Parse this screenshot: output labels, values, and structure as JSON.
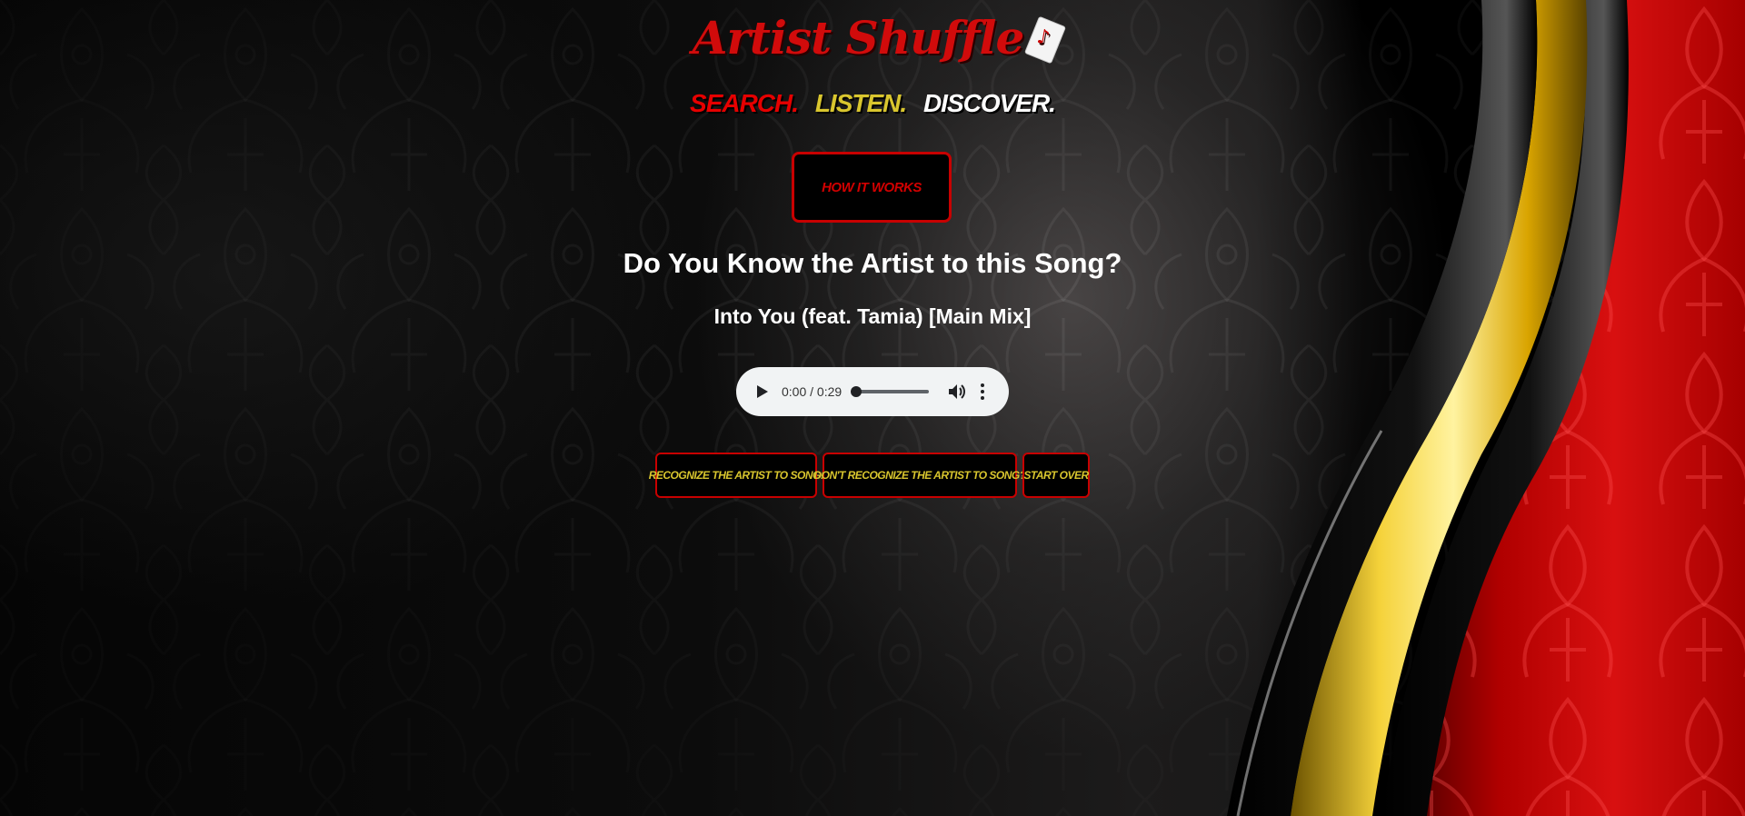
{
  "header": {
    "logo_text": "Artist Shuffle",
    "logo_icon": "music-card-icon",
    "tagline": {
      "search": "SEARCH.",
      "listen": "LISTEN.",
      "discover": "DISCOVER."
    }
  },
  "how_it_works_label": "HOW IT WORKS",
  "main": {
    "question": "Do You Know the Artist to this Song?",
    "song_title": "Into You (feat. Tamia) [Main Mix]"
  },
  "player": {
    "current_time": "0:00",
    "duration": "0:29",
    "time_display": "0:00 / 0:29",
    "progress": 0,
    "icons": [
      "play-icon",
      "volume-icon",
      "more-vert-icon"
    ]
  },
  "actions": {
    "recognize": "RECOGNIZE THE ARTIST TO SONG!",
    "dont_recognize": "DON'T RECOGNIZE THE ARTIST TO SONG?",
    "start_over": "START OVER"
  },
  "colors": {
    "brand_red": "#d10b0b",
    "accent_gold": "#d9c62e",
    "text_white": "#ffffff",
    "button_border": "#c80000"
  }
}
